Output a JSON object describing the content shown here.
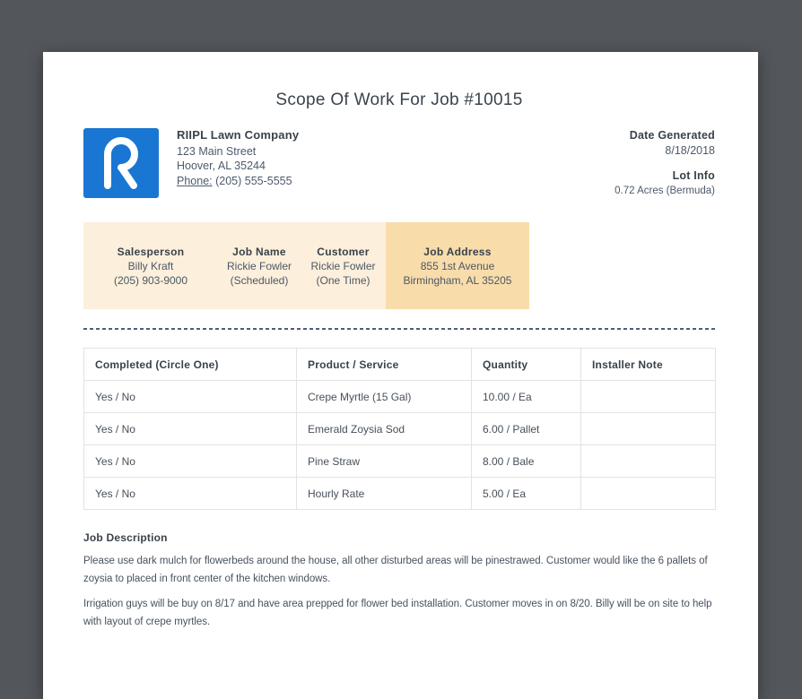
{
  "doc": {
    "title": "Scope Of Work For Job #10015"
  },
  "company": {
    "name": "RIIPL Lawn Company",
    "address_line1": "123 Main Street",
    "address_line2": "Hoover, AL 35244",
    "phone_label": "Phone:",
    "phone_value": " (205) 555-5555"
  },
  "meta": {
    "date_generated_label": "Date Generated",
    "date_generated_value": "8/18/2018",
    "lot_info_label": "Lot Info",
    "lot_info_value": "0.72 Acres (Bermuda)"
  },
  "job_info": {
    "columns": [
      {
        "label": "Salesperson",
        "line1": "Billy Kraft",
        "line2": "(205) 903-9000"
      },
      {
        "label": "Job Name",
        "line1": "Rickie Fowler",
        "line2": "(Scheduled)"
      },
      {
        "label": "Customer",
        "line1": "Rickie Fowler",
        "line2": "(One Time)"
      },
      {
        "label": "Job Address",
        "line1": "855 1st Avenue",
        "line2": "Birmingham, AL 35205"
      }
    ]
  },
  "work_table": {
    "headers": [
      "Completed (Circle One)",
      "Product / Service",
      "Quantity",
      "Installer Note"
    ],
    "rows": [
      {
        "completed": "Yes / No",
        "product": "Crepe Myrtle (15 Gal)",
        "quantity": "10.00 / Ea",
        "note": ""
      },
      {
        "completed": "Yes / No",
        "product": "Emerald Zoysia Sod",
        "quantity": "6.00 / Pallet",
        "note": ""
      },
      {
        "completed": "Yes / No",
        "product": "Pine Straw",
        "quantity": "8.00 / Bale",
        "note": ""
      },
      {
        "completed": "Yes / No",
        "product": "Hourly Rate",
        "quantity": "5.00 / Ea",
        "note": ""
      }
    ]
  },
  "job_description": {
    "heading": "Job Description",
    "paragraph1": "Please use dark mulch for flowerbeds around the house, all other disturbed areas will be pinestrawed. Customer would like the 6 pallets of zoysia to placed in front center of the kitchen windows.",
    "paragraph2": "Irrigation guys will be buy on 8/17 and have area prepped for flower bed installation. Customer moves in on 8/20. Billy will be on site to help with layout of crepe myrtles."
  },
  "colors": {
    "background": "#53575b",
    "logo_blue": "#1976d2",
    "band_light": "#fcefdb",
    "band_highlight": "#f8dcaa",
    "divider_dash": "#4e5d7c",
    "heading_text": "#39424b",
    "body_text": "#4c5a6c"
  }
}
